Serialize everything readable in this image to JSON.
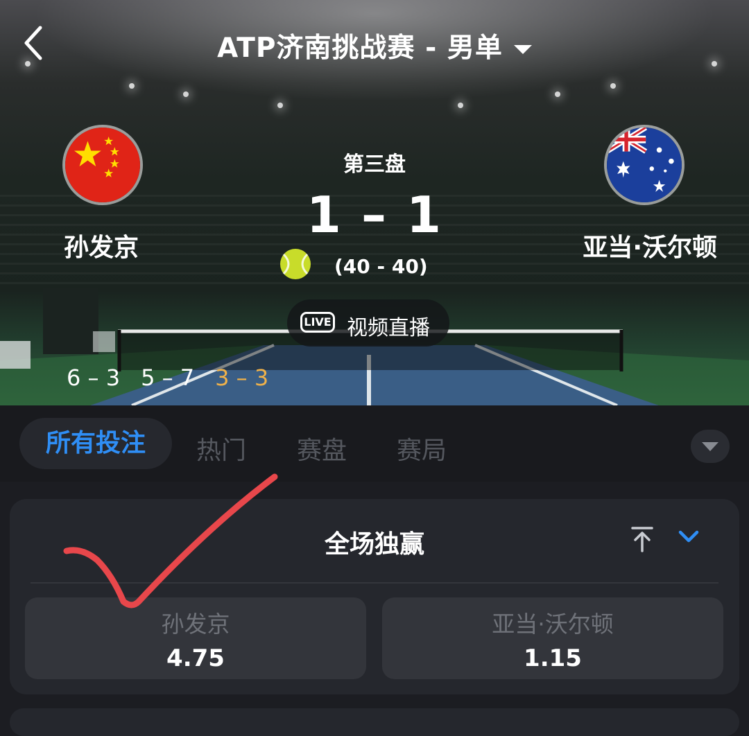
{
  "header": {
    "title": "ATP济南挑战赛 - 男单",
    "back_icon": "back-arrow-icon",
    "dropdown_icon": "caret-down-icon"
  },
  "match": {
    "set_label": "第三盘",
    "score": "1 – 1",
    "game_score": "(40 - 40)",
    "player1": {
      "name": "孙发京",
      "flag": "china-flag-icon"
    },
    "player2": {
      "name": "亚当·沃尔顿",
      "flag": "australia-flag-icon"
    },
    "live_badge": "LIVE",
    "live_label": "视频直播",
    "set_scores": [
      "6 – 3",
      "5 – 7",
      "3 – 3"
    ]
  },
  "tabs": {
    "items": [
      "所有投注",
      "热门",
      "赛盘",
      "赛局"
    ],
    "active": "所有投注"
  },
  "market": {
    "title": "全场独赢",
    "options": [
      {
        "name": "孙发京",
        "odds": "4.75"
      },
      {
        "name": "亚当·沃尔顿",
        "odds": "1.15"
      }
    ]
  },
  "colors": {
    "accent_blue": "#2f8ef5",
    "current_set": "#f0b24a",
    "checkmark": "#e8474b",
    "background": "#1c1d22"
  }
}
